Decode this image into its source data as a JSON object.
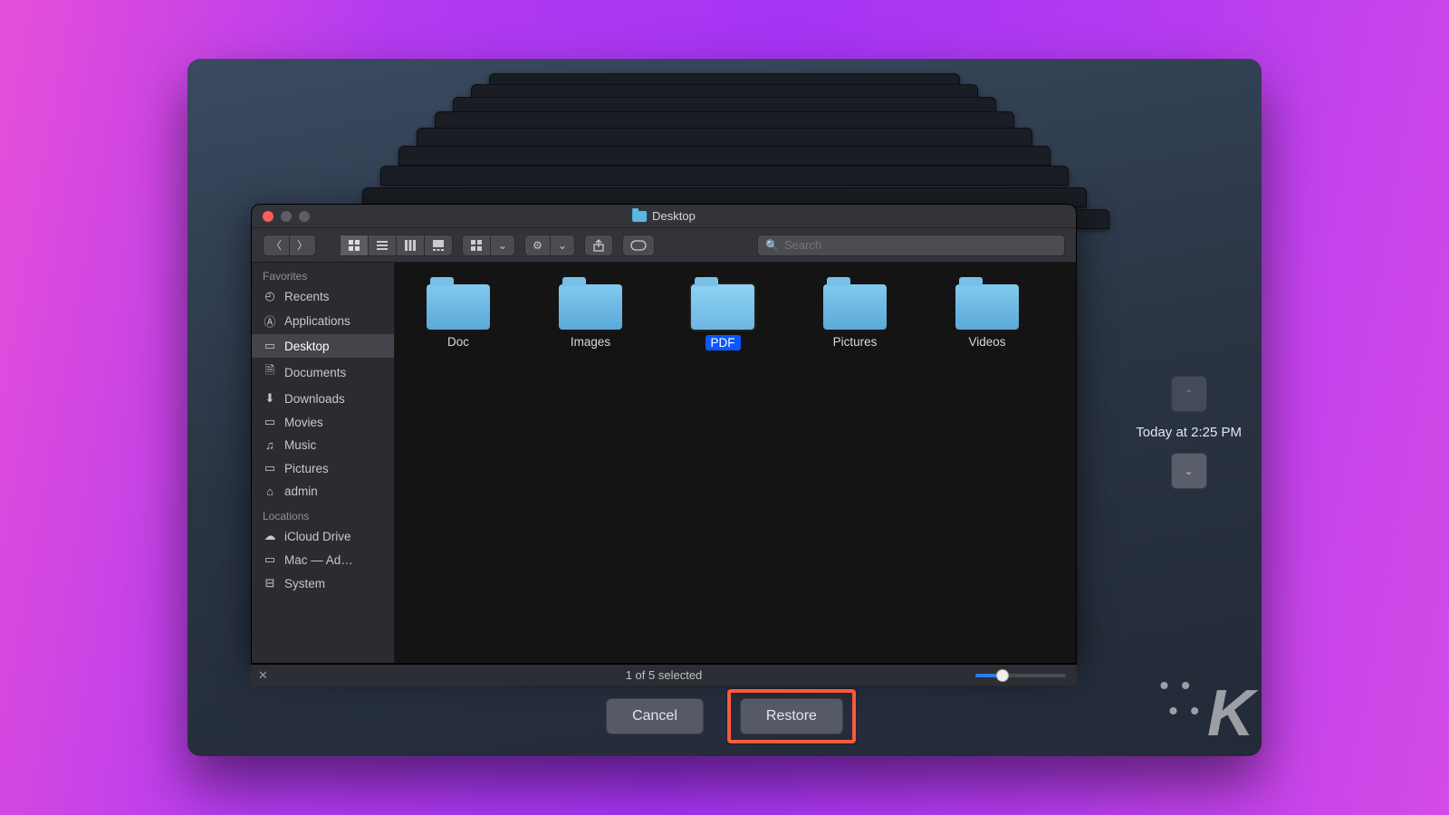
{
  "window": {
    "title": "Desktop"
  },
  "toolbar": {
    "search_placeholder": "Search"
  },
  "sidebar": {
    "section_favorites": "Favorites",
    "section_locations": "Locations",
    "favorites": [
      {
        "label": "Recents",
        "icon": "◴"
      },
      {
        "label": "Applications",
        "icon": "Ⓐ"
      },
      {
        "label": "Desktop",
        "icon": "▭"
      },
      {
        "label": "Documents",
        "icon": "🗎"
      },
      {
        "label": "Downloads",
        "icon": "⬇"
      },
      {
        "label": "Movies",
        "icon": "▭"
      },
      {
        "label": "Music",
        "icon": "♫"
      },
      {
        "label": "Pictures",
        "icon": "▭"
      },
      {
        "label": "admin",
        "icon": "⌂"
      }
    ],
    "locations": [
      {
        "label": "iCloud Drive",
        "icon": "☁"
      },
      {
        "label": "Mac — Ad…",
        "icon": "▭"
      },
      {
        "label": "System",
        "icon": "⊟"
      }
    ]
  },
  "grid": {
    "items": [
      {
        "name": "Doc"
      },
      {
        "name": "Images"
      },
      {
        "name": "PDF",
        "selected": true
      },
      {
        "name": "Pictures"
      },
      {
        "name": "Videos"
      }
    ]
  },
  "status": {
    "text": "1 of 5 selected"
  },
  "actions": {
    "cancel": "Cancel",
    "restore": "Restore"
  },
  "timeline": {
    "label": "Today at 2:25 PM"
  }
}
